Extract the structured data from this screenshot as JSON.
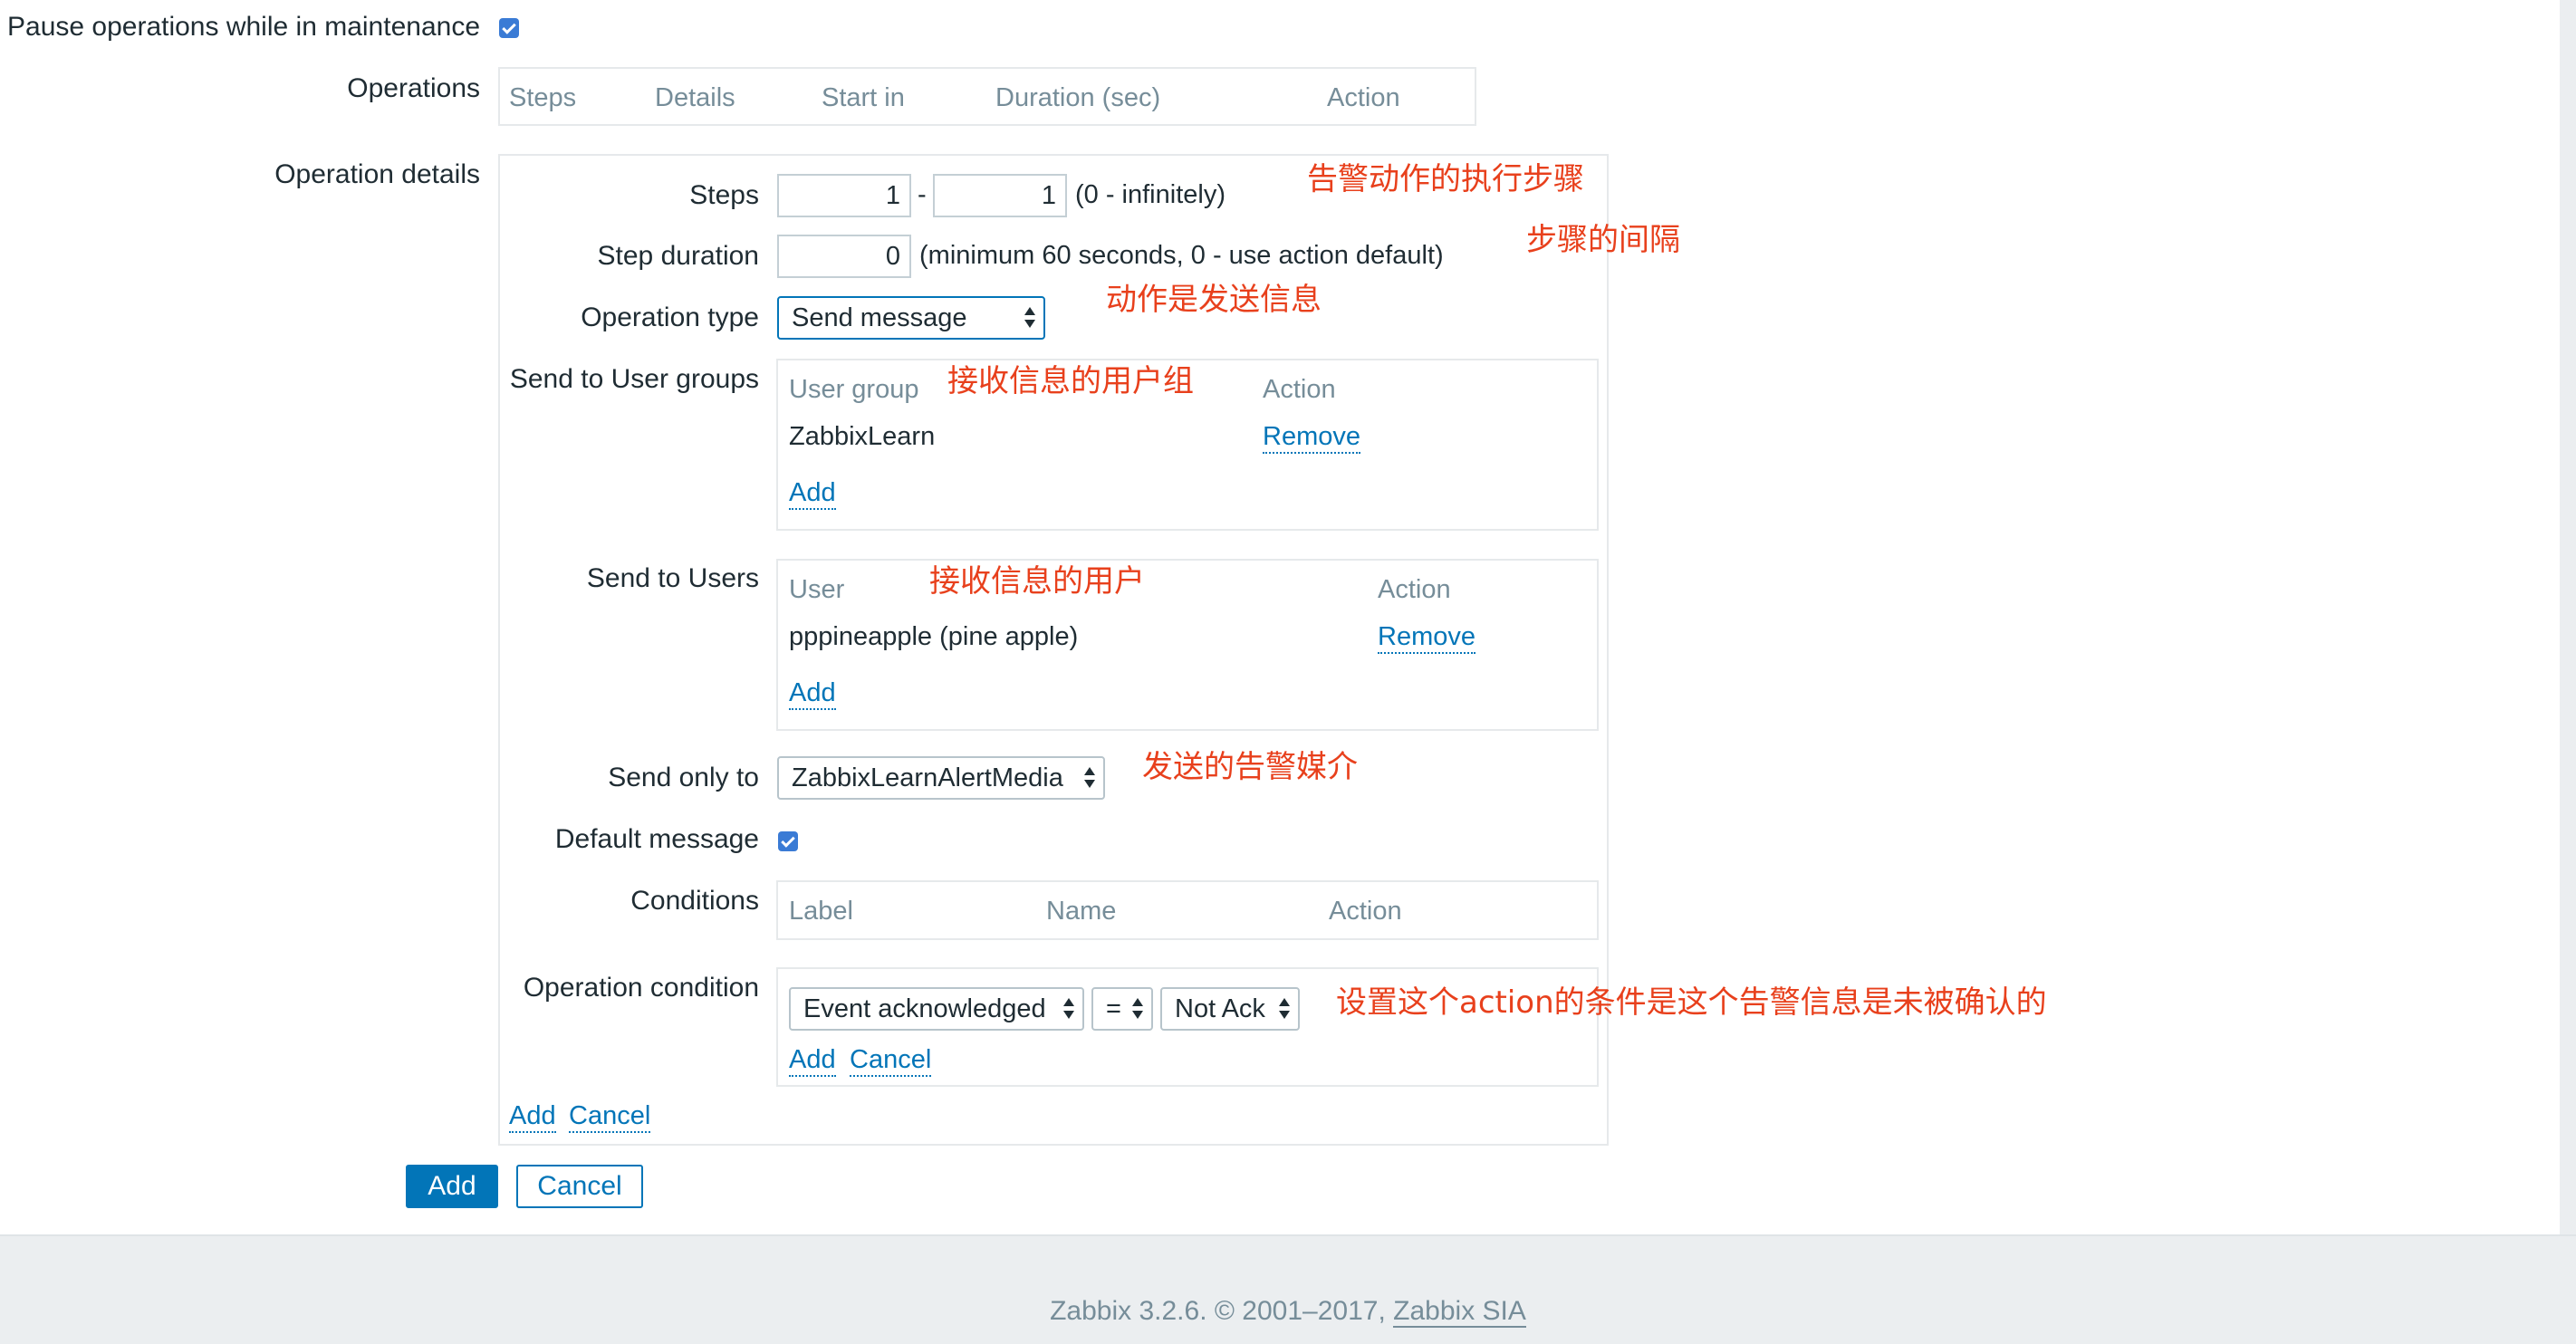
{
  "pause_operations": {
    "label": "Pause operations while in maintenance",
    "checked": true
  },
  "operations": {
    "label": "Operations",
    "columns": [
      "Steps",
      "Details",
      "Start in",
      "Duration (sec)",
      "Action"
    ]
  },
  "operation_details": {
    "label": "Operation details",
    "steps": {
      "label": "Steps",
      "from": "1",
      "separator": "-",
      "to": "1",
      "hint": "(0 - infinitely)"
    },
    "step_duration": {
      "label": "Step duration",
      "value": "0",
      "hint": "(minimum 60 seconds, 0 - use action default)"
    },
    "operation_type": {
      "label": "Operation type",
      "selected": "Send message"
    },
    "send_to_user_groups": {
      "label": "Send to User groups",
      "columns": [
        "User group",
        "Action"
      ],
      "rows": [
        {
          "name": "ZabbixLearn",
          "action": "Remove"
        }
      ],
      "add": "Add"
    },
    "send_to_users": {
      "label": "Send to Users",
      "columns": [
        "User",
        "Action"
      ],
      "rows": [
        {
          "name": "pppineapple (pine apple)",
          "action": "Remove"
        }
      ],
      "add": "Add"
    },
    "send_only_to": {
      "label": "Send only to",
      "selected": "ZabbixLearnAlertMedia"
    },
    "default_message": {
      "label": "Default message",
      "checked": true
    },
    "conditions": {
      "label": "Conditions",
      "columns": [
        "Label",
        "Name",
        "Action"
      ]
    },
    "operation_condition": {
      "label": "Operation condition",
      "field": "Event acknowledged",
      "operator": "=",
      "value": "Not Ack",
      "add": "Add",
      "cancel": "Cancel"
    },
    "add": "Add",
    "cancel": "Cancel"
  },
  "form_buttons": {
    "add": "Add",
    "cancel": "Cancel"
  },
  "annotations": {
    "steps": "告警动作的执行步骤",
    "interval": "步骤的间隔",
    "operation_type": "动作是发送信息",
    "user_groups": "接收信息的用户组",
    "users": "接收信息的用户",
    "media": "发送的告警媒介",
    "condition": "设置这个action的条件是这个告警信息是未被确认的"
  },
  "footer": {
    "text": "Zabbix 3.2.6. © 2001–2017,",
    "link": "Zabbix SIA"
  },
  "colors": {
    "accent": "#0275b8",
    "annotation": "#e8401c",
    "header_text": "#768d99"
  }
}
